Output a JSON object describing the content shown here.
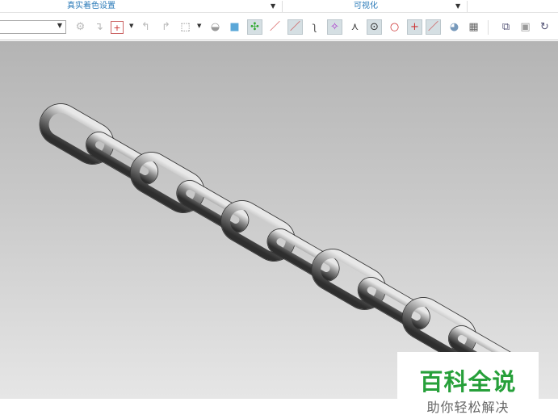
{
  "ribbon_groups": [
    {
      "label": "真实着色设置"
    },
    {
      "label": "可视化"
    }
  ],
  "selection_filter": {
    "value": ""
  },
  "toolbar_icons": [
    "select-feature-icon",
    "snap-icon",
    "filter-icon",
    "undo-select-icon",
    "redo-select-icon",
    "box-select-icon",
    "shaded-body-icon",
    "solid-body-icon",
    "point-on-object-icon",
    "line-icon",
    "line-midpoint-icon",
    "curve-icon",
    "polyline-icon",
    "intersection-icon",
    "center-point-icon",
    "quadrant-point-icon",
    "cross-point-icon",
    "tangent-line-icon",
    "face-icon",
    "grid-icon",
    "fit-view-icon",
    "zoom-window-icon",
    "rotate-icon"
  ],
  "watermark": {
    "title": "百科全说",
    "subtitle": "助你轻松解决"
  }
}
